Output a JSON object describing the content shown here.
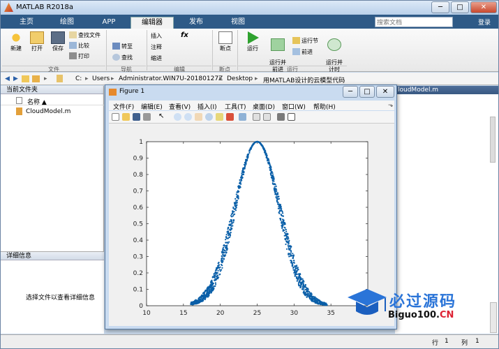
{
  "window": {
    "title": "MATLAB R2018a",
    "min": "─",
    "max": "□",
    "close": "✕"
  },
  "tabs": [
    "主页",
    "绘图",
    "APP",
    "编辑器",
    "发布",
    "视图"
  ],
  "search": {
    "placeholder": "搜索文档"
  },
  "login": "登录",
  "ribbon": {
    "file": {
      "new": "新建",
      "open": "打开",
      "save": "保存",
      "find_files": "查找文件",
      "compare": "比较",
      "print": "打印",
      "group": "文件"
    },
    "nav": {
      "goto": "转至",
      "find": "查找",
      "group": "导航"
    },
    "edit": {
      "insert": "插入",
      "comment": "注释",
      "indent": "缩进",
      "fx": "fx",
      "group": "编辑"
    },
    "breakpoints": {
      "label": "断点",
      "group": "断点"
    },
    "run": {
      "run": "运行",
      "run_advance": "运行并\n前进",
      "run_section": "运行节",
      "advance": "前进",
      "run_time": "运行并\n计时",
      "group": "运行"
    }
  },
  "address": {
    "parts": [
      "C:",
      "Users",
      "Administrator.WIN7U-20180127Z",
      "Desktop",
      "用MATLAB设计的云模型代码"
    ]
  },
  "left": {
    "header": "当前文件夹",
    "col": "名称 ▲",
    "file": "CloudModel.m"
  },
  "detail": {
    "header": "详细信息",
    "msg": "选择文件以查看详细信息"
  },
  "right": {
    "tab": "loudModel.m"
  },
  "status": {
    "row_label": "行",
    "row": "1",
    "col_label": "列",
    "col": "1"
  },
  "figure": {
    "title": "Figure 1",
    "menu": [
      "文件(F)",
      "编辑(E)",
      "查看(V)",
      "插入(I)",
      "工具(T)",
      "桌面(D)",
      "窗口(W)",
      "帮助(H)"
    ]
  },
  "chart_data": {
    "type": "scatter",
    "xlim": [
      10,
      40
    ],
    "ylim": [
      0,
      1
    ],
    "xticks": [
      10,
      15,
      20,
      25,
      30,
      35
    ],
    "yticks": [
      0,
      0.1,
      0.2,
      0.3,
      0.4,
      0.5,
      0.6,
      0.7,
      0.8,
      0.9,
      1
    ],
    "title": "",
    "xlabel": "",
    "ylabel": "",
    "color": "#0a5fa8",
    "series": [
      {
        "curve": "gaussian",
        "center": 25,
        "spread": 3.0,
        "x_range": [
          16.0,
          34.5
        ]
      }
    ]
  },
  "watermark": {
    "title": "必过源码",
    "sub_prefix": "Biguo100.",
    "sub_suffix": "CN"
  }
}
